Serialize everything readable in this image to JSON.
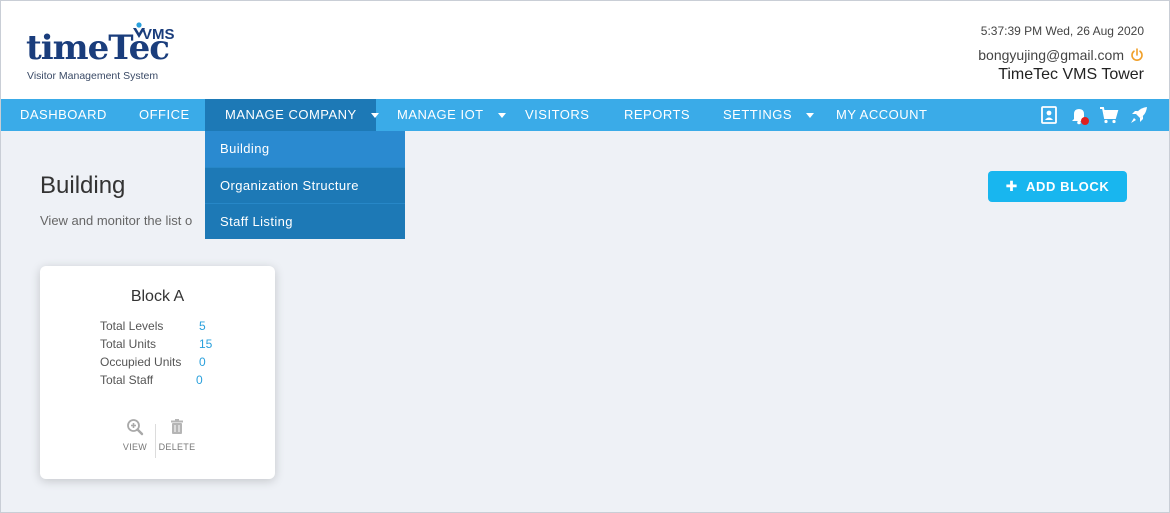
{
  "header": {
    "logo": {
      "wordmark": "timeTec",
      "product": "VMS",
      "subtitle": "Visitor Management System"
    },
    "datetime": "5:37:39 PM  Wed, 26 Aug 2020",
    "email": "bongyujing@gmail.com",
    "building_name": "TimeTec VMS Tower"
  },
  "navbar": {
    "items": [
      {
        "label": "DASHBOARD"
      },
      {
        "label": "OFFICE"
      },
      {
        "label": "MANAGE COMPANY"
      },
      {
        "label": "MANAGE IOT"
      },
      {
        "label": "VISITORS"
      },
      {
        "label": "REPORTS"
      },
      {
        "label": "SETTINGS"
      },
      {
        "label": "MY ACCOUNT"
      }
    ],
    "icons": [
      "contact-card-icon",
      "notification-bell-icon",
      "cart-icon",
      "rocket-icon"
    ]
  },
  "dropdown": {
    "items": [
      {
        "label": "Building"
      },
      {
        "label": "Organization Structure"
      },
      {
        "label": "Staff Listing"
      }
    ]
  },
  "page": {
    "title": "Building",
    "subtitle": "View and monitor the list o",
    "add_button": "ADD BLOCK"
  },
  "card": {
    "title": "Block A",
    "stats": [
      {
        "label": "Total Levels",
        "value": "5"
      },
      {
        "label": "Total Units",
        "value": "15"
      },
      {
        "label": "Occupied Units",
        "value": "0"
      },
      {
        "label": "Total Staff",
        "value": "0"
      }
    ],
    "view_label": "VIEW",
    "delete_label": "DELETE"
  },
  "colors": {
    "navbar": "#3aabe8",
    "navbar_active": "#1d79b6",
    "accent_button": "#18b6ef",
    "stat_value": "#2aa0dc",
    "power_icon": "#f0a02a",
    "notification_dot": "#e01f1f"
  }
}
